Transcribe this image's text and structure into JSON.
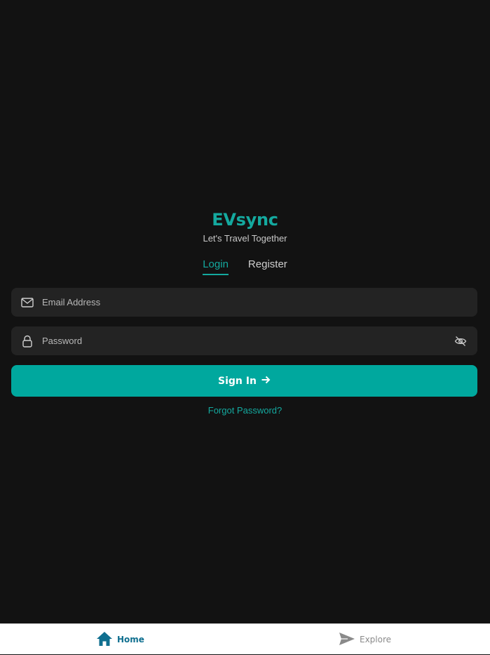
{
  "brand": {
    "title": "EVsync",
    "tagline": "Let's Travel Together"
  },
  "tabs": [
    {
      "label": "Login",
      "active": true
    },
    {
      "label": "Register",
      "active": false
    }
  ],
  "form": {
    "email_placeholder": "Email Address",
    "email_value": "",
    "password_placeholder": "Password",
    "password_value": "",
    "signin_label": "Sign In",
    "forgot_label": "Forgot Password?"
  },
  "bottom_nav": {
    "items": [
      {
        "label": "Home",
        "icon": "home-icon",
        "active": true
      },
      {
        "label": "Explore",
        "icon": "send-icon",
        "active": false
      }
    ]
  },
  "colors": {
    "accent": "#14a99f",
    "button": "#00a89e",
    "background": "#121212",
    "field": "#232323",
    "nav_active": "#0f6f8f",
    "nav_inactive": "#8a8a8a"
  }
}
